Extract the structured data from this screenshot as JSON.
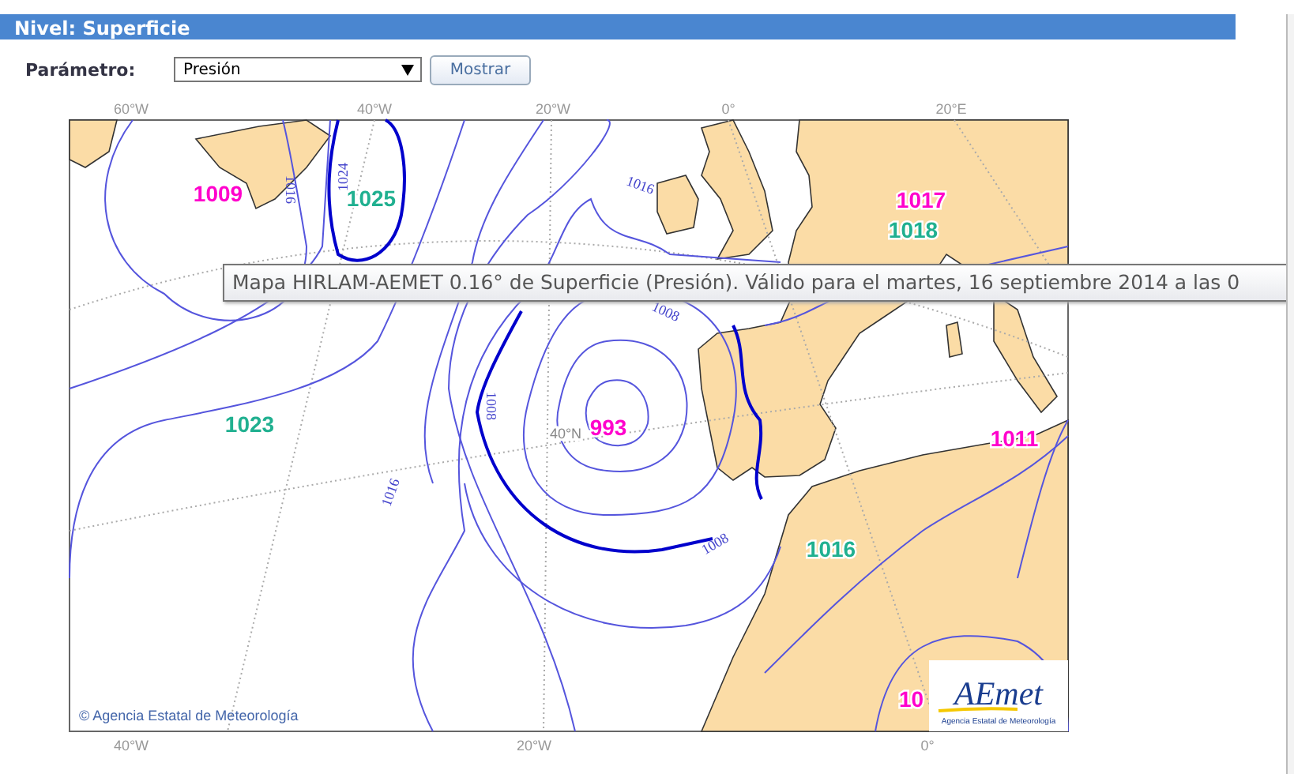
{
  "header": {
    "title": "Nivel: Superficie"
  },
  "parameter": {
    "label": "Parámetro:",
    "value": "Presión",
    "button": "Mostrar"
  },
  "map": {
    "top_axis_labels": [
      "60°W",
      "40°W",
      "20°W",
      "0°",
      "20°E"
    ],
    "bottom_axis_labels": [
      "40°W",
      "20°W",
      "0°"
    ],
    "pressure_centers": [
      {
        "value": "1009",
        "color": "#ff00cc"
      },
      {
        "value": "1025",
        "color": "#20b090"
      },
      {
        "value": "1017",
        "color": "#ff00cc"
      },
      {
        "value": "1018",
        "color": "#20b090"
      },
      {
        "value": "1023",
        "color": "#20b090"
      },
      {
        "value": "993",
        "color": "#ff00cc"
      },
      {
        "value": "1011",
        "color": "#ff00cc"
      },
      {
        "value": "1016",
        "color": "#20b090"
      },
      {
        "value": "10",
        "color": "#ff00cc"
      }
    ],
    "isobar_labels": [
      "1016",
      "1024",
      "1016",
      "1008",
      "1008",
      "1016",
      "1008"
    ],
    "latitude_label": "40°N",
    "copyright": "© Agencia Estatal de Meteorología",
    "logo": {
      "name": "AEmet",
      "subtitle": "Agencia Estatal de Meteorología"
    }
  },
  "tooltip": "Mapa HIRLAM-AEMET 0.16° de Superficie (Presión). Válido para el martes, 16 septiembre 2014 a las 0"
}
